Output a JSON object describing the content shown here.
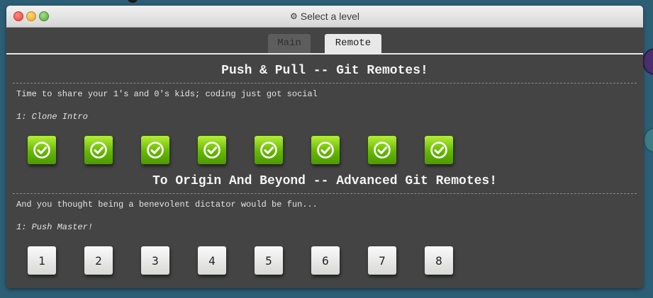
{
  "window": {
    "title": "Select a level",
    "title_icon": "gear-icon"
  },
  "tabs": [
    {
      "label": "Main",
      "selected": false
    },
    {
      "label": "Remote",
      "selected": true
    }
  ],
  "sequences": [
    {
      "title": "Push & Pull -- Git Remotes!",
      "about": "Time to share your 1's and 0's kids; coding just got social",
      "current_level": "1: Clone Intro",
      "levels": [
        {
          "status": "solved",
          "icon": "check-icon"
        },
        {
          "status": "solved",
          "icon": "check-icon"
        },
        {
          "status": "solved",
          "icon": "check-icon"
        },
        {
          "status": "solved",
          "icon": "check-icon"
        },
        {
          "status": "solved",
          "icon": "check-icon"
        },
        {
          "status": "solved",
          "icon": "check-icon"
        },
        {
          "status": "solved",
          "icon": "check-icon"
        },
        {
          "status": "solved",
          "icon": "check-icon"
        }
      ]
    },
    {
      "title": "To Origin And Beyond -- Advanced Git Remotes!",
      "about": "And you thought being a benevolent dictator would be fun...",
      "current_level": "1: Push Master!",
      "levels": [
        {
          "label": "1",
          "status": "unsolved"
        },
        {
          "label": "2",
          "status": "unsolved"
        },
        {
          "label": "3",
          "status": "unsolved"
        },
        {
          "label": "4",
          "status": "unsolved"
        },
        {
          "label": "5",
          "status": "unsolved"
        },
        {
          "label": "6",
          "status": "unsolved"
        },
        {
          "label": "7",
          "status": "unsolved"
        },
        {
          "label": "8",
          "status": "unsolved"
        }
      ]
    }
  ],
  "colors": {
    "solved_green": "#65b800",
    "window_bg": "#444444",
    "desktop_bg": "#2c5e76"
  }
}
